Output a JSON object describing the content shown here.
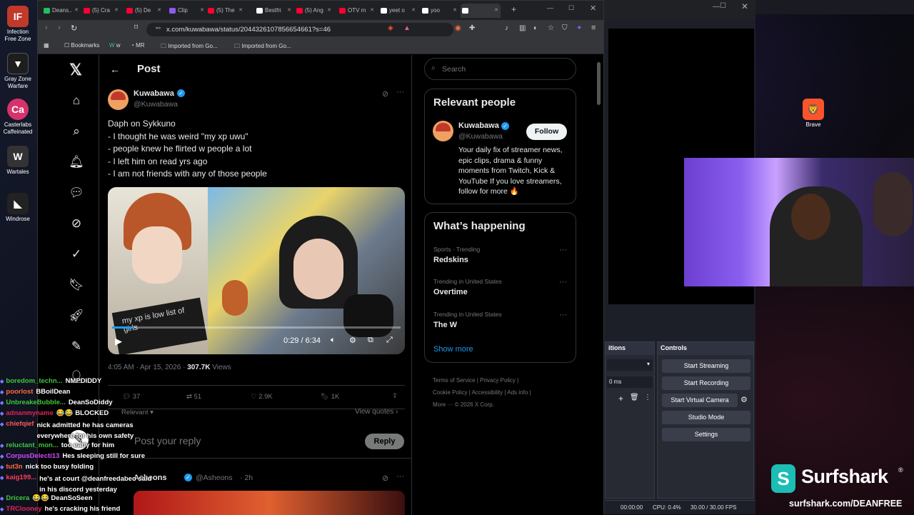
{
  "desktop_icons": [
    {
      "label": "Infection Free Zone",
      "color": "#c0392b",
      "glyph": "IF"
    },
    {
      "label": "Gray Zone Warfare",
      "color": "#1e1e1e",
      "glyph": "▼"
    },
    {
      "label": "Casterlabs Caffeinated",
      "color": "#d6336c",
      "glyph": "Ca"
    },
    {
      "label": "Wartales",
      "color": "#333",
      "glyph": "W"
    },
    {
      "label": "Windrose",
      "color": "#222",
      "glyph": "◣"
    },
    {
      "label": "Brave",
      "color": "#fb542b",
      "glyph": "🦁"
    }
  ],
  "browser": {
    "tabs": [
      {
        "label": "Deans..",
        "color": "#21c063"
      },
      {
        "label": "(5) Cra",
        "color": "#ff0033"
      },
      {
        "label": "(5) De",
        "color": "#ff0033"
      },
      {
        "label": "Clip",
        "color": "#8a5cf5"
      },
      {
        "label": "(5) The",
        "color": "#ff0033"
      },
      {
        "label": "Bestfri",
        "color": "#fff"
      },
      {
        "label": "(5) Ang",
        "color": "#ff0033"
      },
      {
        "label": "OTV m",
        "color": "#ff0033"
      },
      {
        "label": "yeet o",
        "color": "#fff"
      },
      {
        "label": "yoo",
        "color": "#fff"
      },
      {
        "label": "",
        "color": "#fff",
        "active": true
      }
    ],
    "new_tab": "+",
    "url": "x.com/kuwabawa/status/2044326107856654661?s=46",
    "bookmarks": [
      "Bookmarks",
      "w",
      "MR",
      "Imported from Go...",
      "Imported from Go..."
    ]
  },
  "x": {
    "header_title": "Post",
    "author": {
      "name": "Kuwabawa",
      "handle": "@Kuwabawa"
    },
    "tweet_lines": [
      "Daph on Sykkuno",
      "- I thought he was weird \"my xp uwu\"",
      "- people knew he flirted w people a lot",
      "- I left him on read yrs ago",
      "- I am not friends with any of those people"
    ],
    "video": {
      "time": "0:29 / 6:34",
      "overlay_text": "my xp is low list of girls",
      "progress": 0.074
    },
    "meta": {
      "time": "4:05 AM · Apr 15, 2026 ·",
      "views_count": "307.7K",
      "views_label": "Views"
    },
    "actions": {
      "replies": "37",
      "retweets": "51",
      "likes": "2.9K",
      "bookmarks": "1K"
    },
    "relevant_dropdown": "Relevant",
    "view_quotes": "View quotes",
    "reply_placeholder": "Post your reply",
    "reply_button": "Reply",
    "next_reply": {
      "name": "Asheons",
      "handle": "@Asheons",
      "time": "· 2h"
    },
    "search_placeholder": "Search",
    "relevant_people": {
      "title": "Relevant people",
      "name": "Kuwabawa",
      "handle": "@Kuwabawa",
      "follow": "Follow",
      "bio": "Your daily fix of streamer news, epic clips, drama & funny moments from Twitch, Kick & YouTube If you love streamers, follow for more 🔥"
    },
    "happening": {
      "title": "What’s happening",
      "items": [
        {
          "context": "Sports · Trending",
          "topic": "Redskins"
        },
        {
          "context": "Trending in United States",
          "topic": "Overtime"
        },
        {
          "context": "Trending in United States",
          "topic": "The W"
        }
      ],
      "show_more": "Show more"
    },
    "footer_links": [
      "Terms of Service",
      "Privacy Policy",
      "Cookie Policy",
      "Accessibility",
      "Ads info",
      "More ···",
      "© 2026 X Corp."
    ]
  },
  "obs": {
    "transitions_label": "itions",
    "transition_ms": "0 ms",
    "controls_title": "Controls",
    "buttons": [
      "Start Streaming",
      "Start Recording",
      "Start Virtual Camera",
      "Studio Mode",
      "Settings"
    ],
    "status": {
      "time": "00:00:00",
      "cpu": "CPU: 0.4%",
      "fps": "30.00 / 30.00 FPS"
    }
  },
  "chat": [
    {
      "user": "boredom_techn...",
      "msg": "NMPDIDDY",
      "color": "#3cc83c"
    },
    {
      "user": "poorlost",
      "msg": "BBoilDean",
      "color": "#ff6a3d"
    },
    {
      "user": "UnbreakeBubble...",
      "msg": "DeanSoDiddy",
      "color": "#3cc83c"
    },
    {
      "user": "adnanmyname",
      "msg": "😂😂 BLOCKED",
      "color": "#e0245e"
    },
    {
      "user": "chiefqief",
      "msg": "nick admitted he has cameras everywhere for his own safety",
      "color": "#ff5a5a"
    },
    {
      "user": "reluctant_mon...",
      "msg": "too early for him",
      "color": "#3cc83c"
    },
    {
      "user": "CorpusDelecti13",
      "msg": "Hes sleeping still for sure",
      "color": "#d34aff"
    },
    {
      "user": "tut3n",
      "msg": "nick too busy folding",
      "color": "#ff6a3d"
    },
    {
      "user": "kaig199...",
      "msg": "he's at court @deanfreedabeo said in his discord yesterday",
      "color": "#ff3d5a"
    },
    {
      "user": "Dricera",
      "msg": "😂😂 DeanSoSeen",
      "color": "#3cc83c"
    },
    {
      "user": "TRClooney",
      "msg": "he's cracking his friend",
      "color": "#e0245e"
    }
  ],
  "sponsor": {
    "brand": "Surfshark",
    "url": "surfshark.com/DEANFREE"
  }
}
